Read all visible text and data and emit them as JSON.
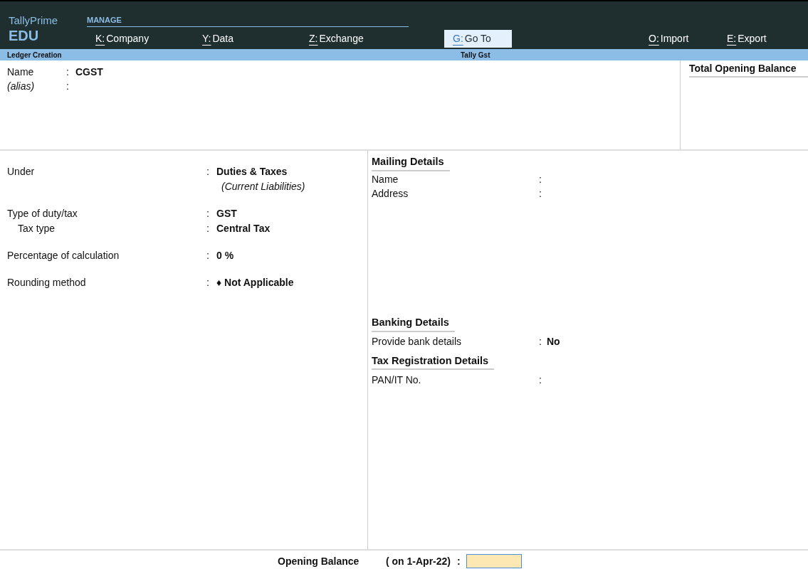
{
  "brand": {
    "name": "TallyPrime",
    "edition": "EDU"
  },
  "menu": {
    "title": "MANAGE",
    "items": [
      {
        "key": "K:",
        "label": "Company",
        "selected": false
      },
      {
        "key": "Y:",
        "label": "Data",
        "selected": false
      },
      {
        "key": "Z:",
        "label": "Exchange",
        "selected": false
      },
      {
        "key": "G:",
        "label": "Go To",
        "selected": true
      },
      {
        "key": "O:",
        "label": "Import",
        "selected": false
      },
      {
        "key": "E:",
        "label": "Export",
        "selected": false
      }
    ]
  },
  "title_bar": {
    "screen": "Ledger Creation",
    "company": "Tally Gst"
  },
  "header_fields": [
    {
      "label": "Name",
      "colon": ":",
      "value": "CGST",
      "italic": false
    },
    {
      "label": "(alias)",
      "colon": ":",
      "italic": true
    }
  ],
  "total_opening_balance": {
    "title": "Total Opening Balance"
  },
  "left_groups": [
    [
      {
        "label": "Under",
        "colon": ":",
        "value": "Duties & Taxes",
        "note": "(Current Liabilities)",
        "indent": false
      }
    ],
    [
      {
        "label": "Type of duty/tax",
        "colon": ":",
        "value": "GST",
        "indent": false
      },
      {
        "label": "Tax type",
        "colon": ":",
        "value": "Central Tax",
        "indent": true
      }
    ],
    [
      {
        "label": "Percentage of calculation",
        "colon": ":",
        "value": "0 %",
        "indent": false
      }
    ],
    [
      {
        "label": "Rounding method",
        "colon": ":",
        "value": "♦ Not Applicable",
        "indent": false
      }
    ]
  ],
  "sections": [
    {
      "title": "Mailing Details",
      "fields": [
        {
          "label": "Name",
          "colon": ":"
        },
        {
          "label": "Address",
          "colon": ":"
        }
      ]
    },
    {
      "title": "Banking Details",
      "fields": [
        {
          "label": "Provide bank details",
          "colon": ":",
          "value": "No"
        }
      ]
    },
    {
      "title": "Tax Registration Details",
      "fields": [
        {
          "label": "PAN/IT No.",
          "colon": ":"
        }
      ]
    }
  ],
  "opening_balance": {
    "label": "Opening Balance",
    "date": "( on 1-Apr-22)",
    "colon": ":"
  }
}
